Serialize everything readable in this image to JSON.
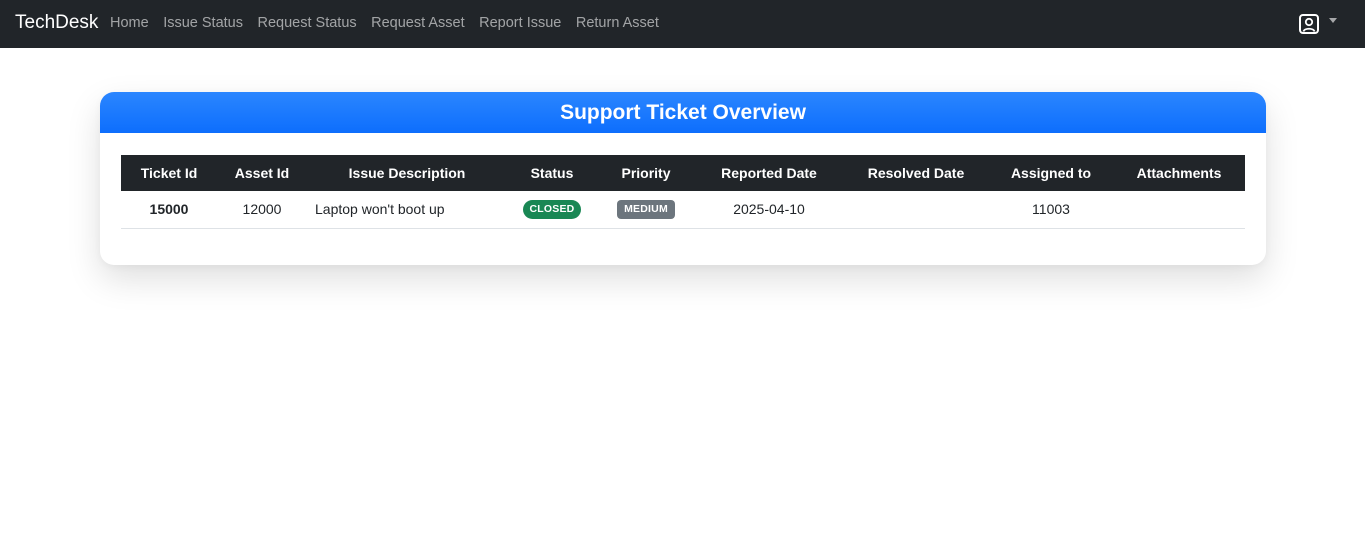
{
  "navbar": {
    "brand": "TechDesk",
    "links": [
      "Home",
      "Issue Status",
      "Request Status",
      "Request Asset",
      "Report Issue",
      "Return Asset"
    ],
    "user_icon": "user-square-icon",
    "dropdown_icon": "caret-down-icon"
  },
  "card": {
    "title": "Support Ticket Overview"
  },
  "table": {
    "headers": [
      "Ticket Id",
      "Asset Id",
      "Issue Description",
      "Status",
      "Priority",
      "Reported Date",
      "Resolved Date",
      "Assigned to",
      "Attachments"
    ],
    "rows": [
      {
        "ticket_id": "15000",
        "asset_id": "12000",
        "description": "Laptop won't boot up",
        "status": "CLOSED",
        "priority": "MEDIUM",
        "reported_date": "2025-04-10",
        "resolved_date": "",
        "assigned_to": "11003",
        "attachments": ""
      }
    ]
  },
  "colors": {
    "navbar_bg": "#212529",
    "header_blue": "#0d6efd",
    "status_closed": "#198754",
    "priority_medium": "#6c757d"
  }
}
